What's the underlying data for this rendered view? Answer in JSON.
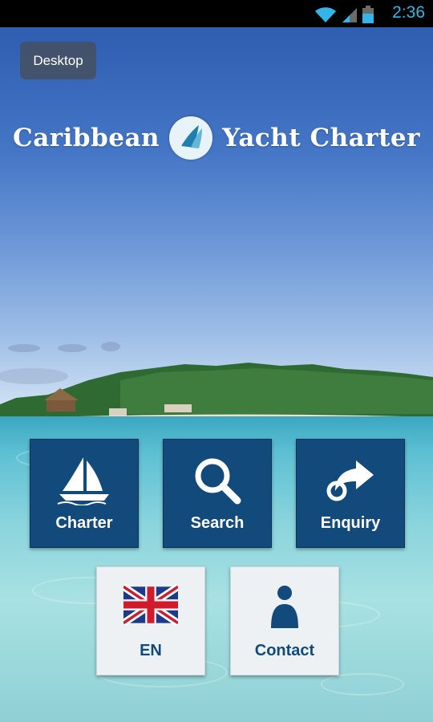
{
  "status_bar": {
    "time": "2:36"
  },
  "header": {
    "desktop_label": "Desktop",
    "logo_left": "Caribbean",
    "logo_right": "Yacht Charter"
  },
  "tiles": {
    "charter": "Charter",
    "search": "Search",
    "enquiry": "Enquiry",
    "language": "EN",
    "contact": "Contact"
  },
  "colors": {
    "tile_blue": "#134a7c",
    "tile_light": "#eef1f4",
    "status_accent": "#33b5e5"
  },
  "icons": [
    "wifi-icon",
    "signal-icon",
    "battery-icon",
    "sailboat-icon",
    "search-icon",
    "share-arrow-icon",
    "uk-flag-icon",
    "person-icon"
  ]
}
